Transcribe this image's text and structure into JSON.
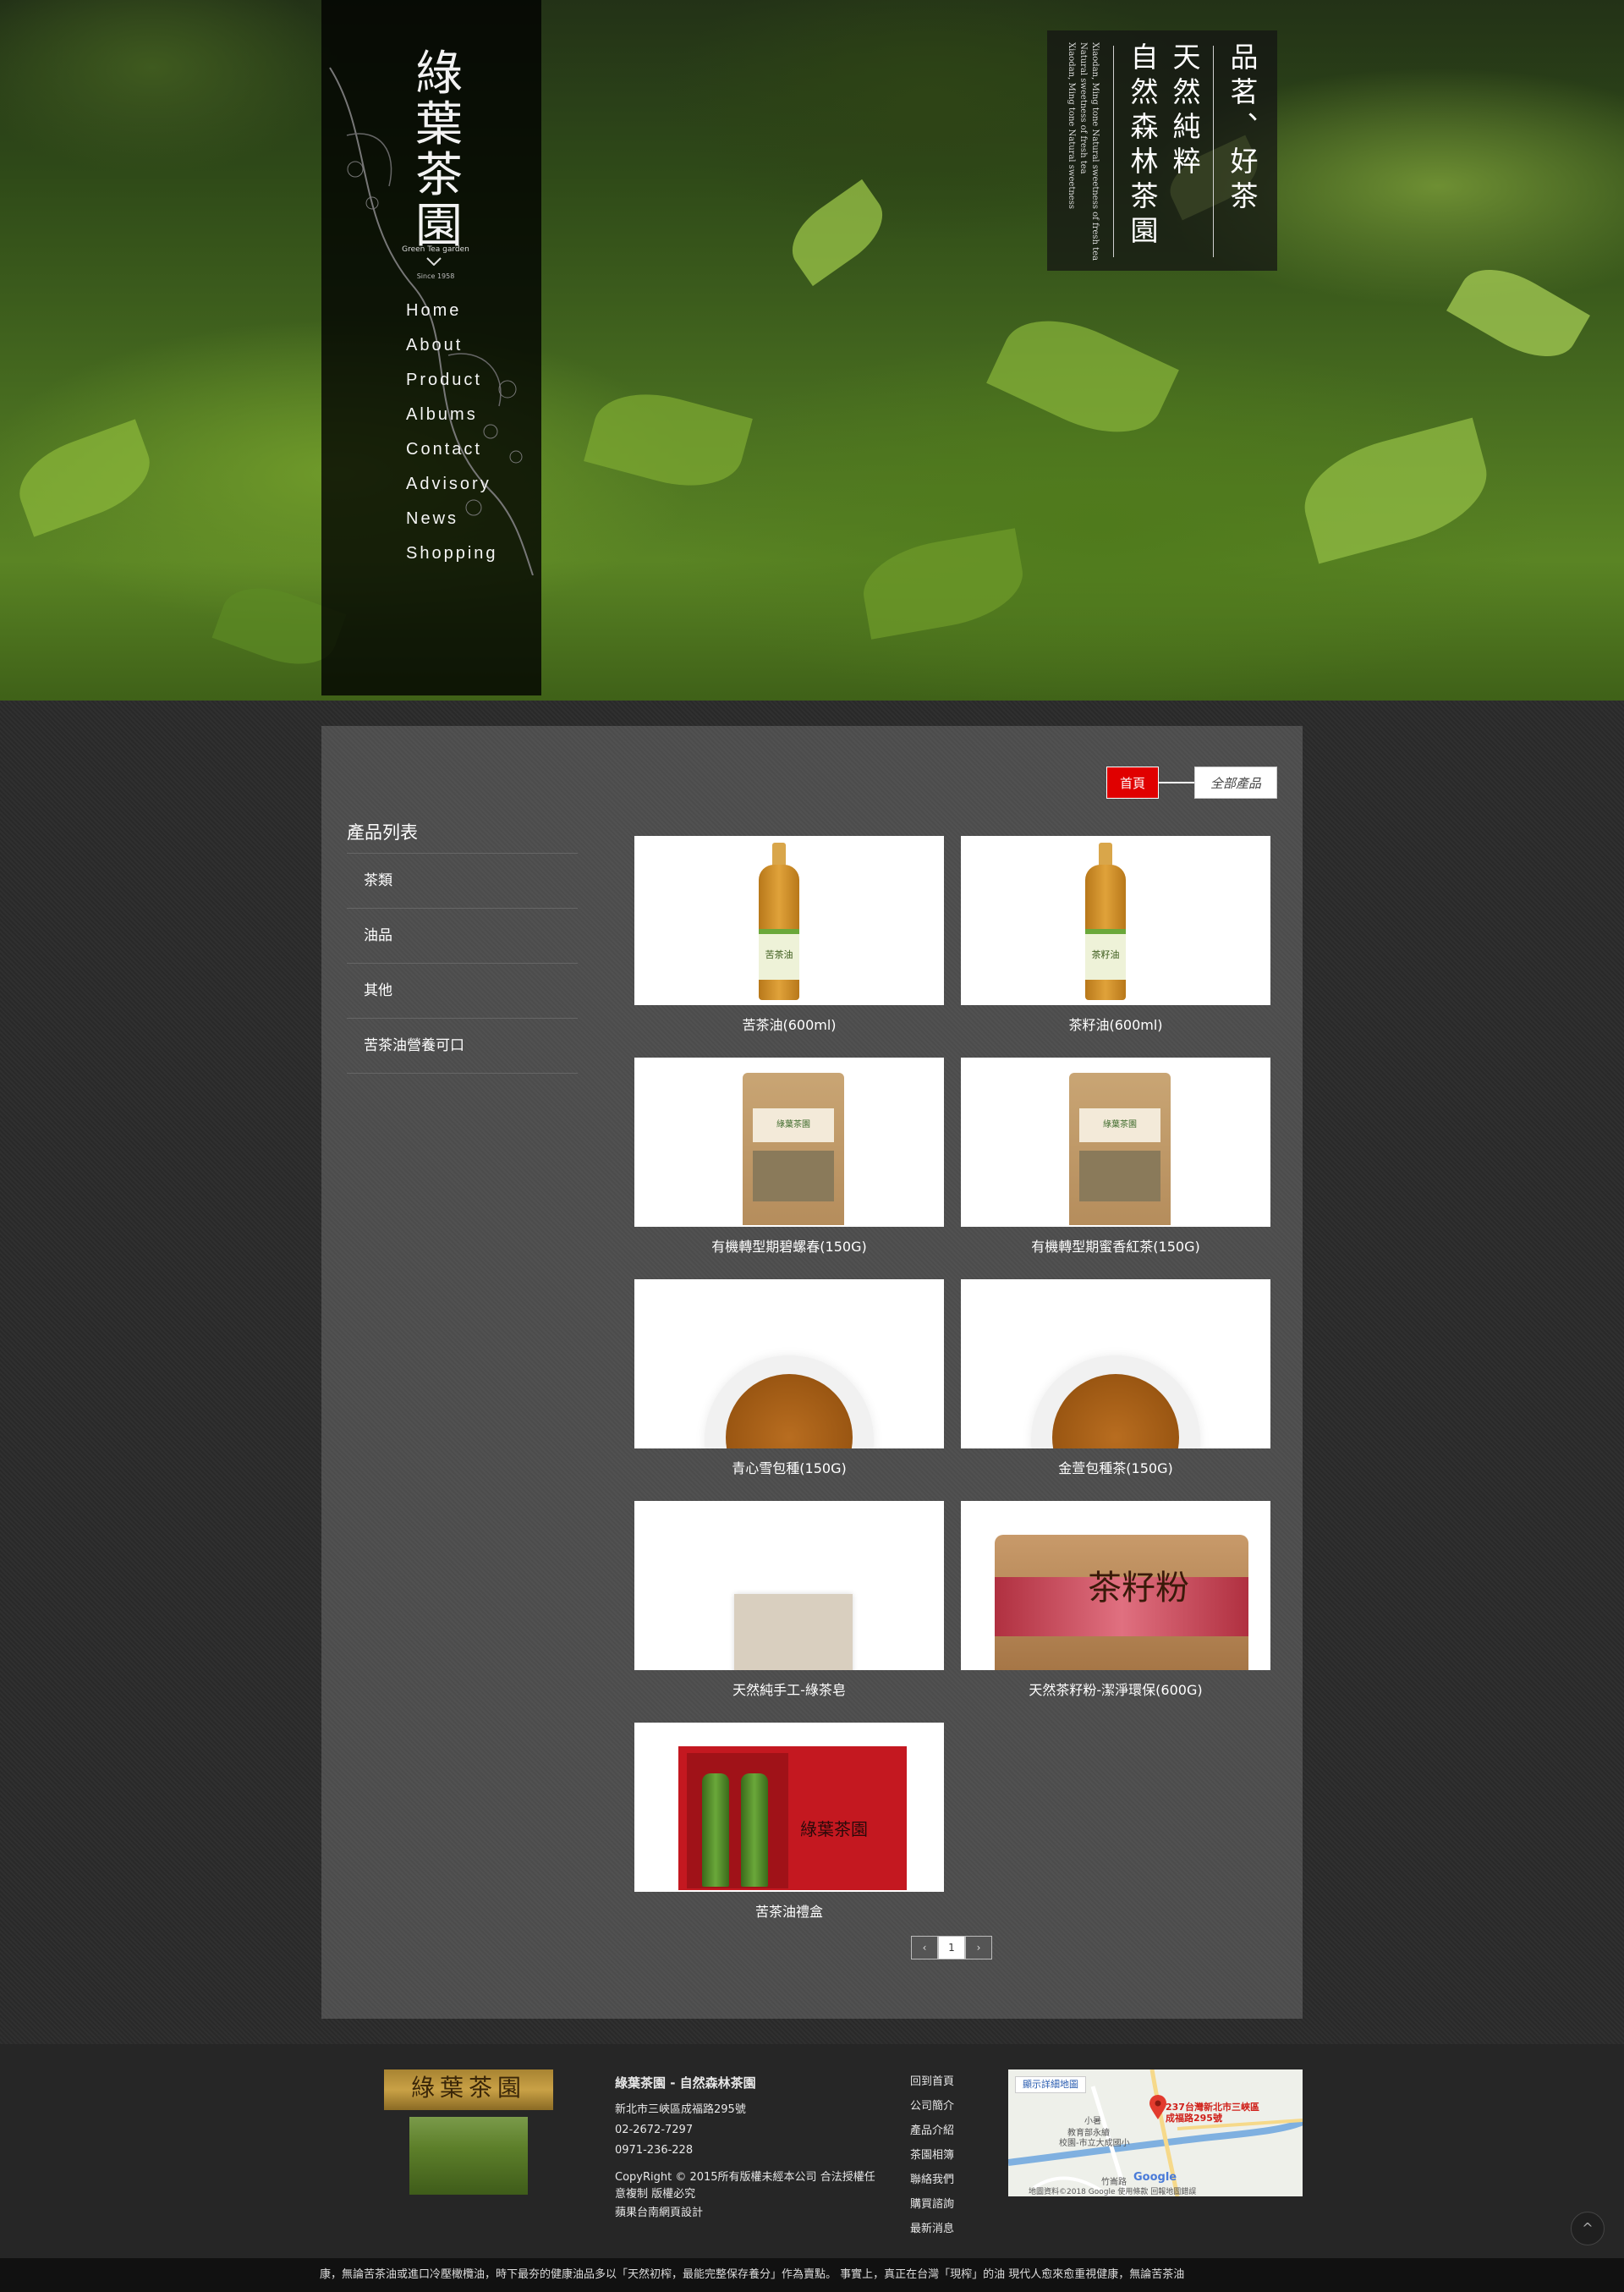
{
  "brand": {
    "logo_text": "綠葉茶園",
    "logo_en": "Green Tea garden",
    "since": "Since 1958"
  },
  "nav": [
    "Home",
    "About",
    "Product",
    "Albums",
    "Contact",
    "Advisory",
    "News",
    "Shopping"
  ],
  "slogan": {
    "col1": "品茗、好茶",
    "col2": "天然純粹",
    "col3": "自然森林茶園",
    "en_lines": [
      "Xiaodan, Ming tone Natural sweetness of fresh tea",
      "Natural sweetness of fresh tea",
      "Xiaodan, Ming tone Natural sweetness"
    ]
  },
  "breadcrumb": {
    "home": "首頁",
    "current": "全部產品"
  },
  "categories": {
    "title": "產品列表",
    "items": [
      "茶類",
      "油品",
      "其他",
      "苦茶油營養可口"
    ]
  },
  "products": [
    {
      "name": "苦茶油(600ml)",
      "kind": "bottle",
      "label": "苦茶油"
    },
    {
      "name": "茶籽油(600ml)",
      "kind": "bottle",
      "label": "茶籽油"
    },
    {
      "name": "有機轉型期碧螺春(150G)",
      "kind": "bag",
      "label": "綠葉茶園"
    },
    {
      "name": "有機轉型期蜜香紅茶(150G)",
      "kind": "bag",
      "label": "綠葉茶園"
    },
    {
      "name": "青心雪包種(150G)",
      "kind": "cup",
      "label": ""
    },
    {
      "name": "金萱包種茶(150G)",
      "kind": "cup",
      "label": ""
    },
    {
      "name": "天然純手工-綠茶皂",
      "kind": "soap",
      "label": ""
    },
    {
      "name": "天然茶籽粉-潔淨環保(600G)",
      "kind": "powder",
      "label": "茶籽粉"
    },
    {
      "name": "苦茶油禮盒",
      "kind": "giftbox",
      "label": "綠葉茶園"
    }
  ],
  "pagination": {
    "prev": "‹",
    "current": "1",
    "next": "›"
  },
  "footer": {
    "logo_text": "綠葉茶園",
    "title": "綠葉茶園 - 自然森林茶園",
    "address": "新北市三峽區成福路295號",
    "phone1": "02-2672-7297",
    "phone2": "0971-236-228",
    "copyright": "CopyRight © 2015所有版權未經本公司 合法授權任意複制 版權必究",
    "designer": "蘋果台南網頁設計",
    "links": [
      "回到首頁",
      "公司簡介",
      "產品介紹",
      "茶園相簿",
      "聯絡我們",
      "購買諮詢",
      "最新消息"
    ],
    "map": {
      "button": "顯示詳細地圖",
      "address": "237台灣新北市三峽區成福路295號",
      "place1": "小暑",
      "place2": "教育部永續",
      "place3": "校園-市立大成國小",
      "place4": "竹崙路",
      "attribution": "地圖資料©2018 Google   使用條款   回報地圖錯誤",
      "google": "Google"
    }
  },
  "marquee": "康，無論苦茶油或進口冷壓橄欖油，時下最夯的健康油品多以「天然初榨，最能完整保存養分」作為賣點。 事實上，真正在台灣「現榨」的油            現代人愈來愈重視健康，無論苦茶油",
  "to_top": "^",
  "colors": {
    "accent_red": "#e00000",
    "panel": "#4e4e4e",
    "footer": "#262626"
  }
}
